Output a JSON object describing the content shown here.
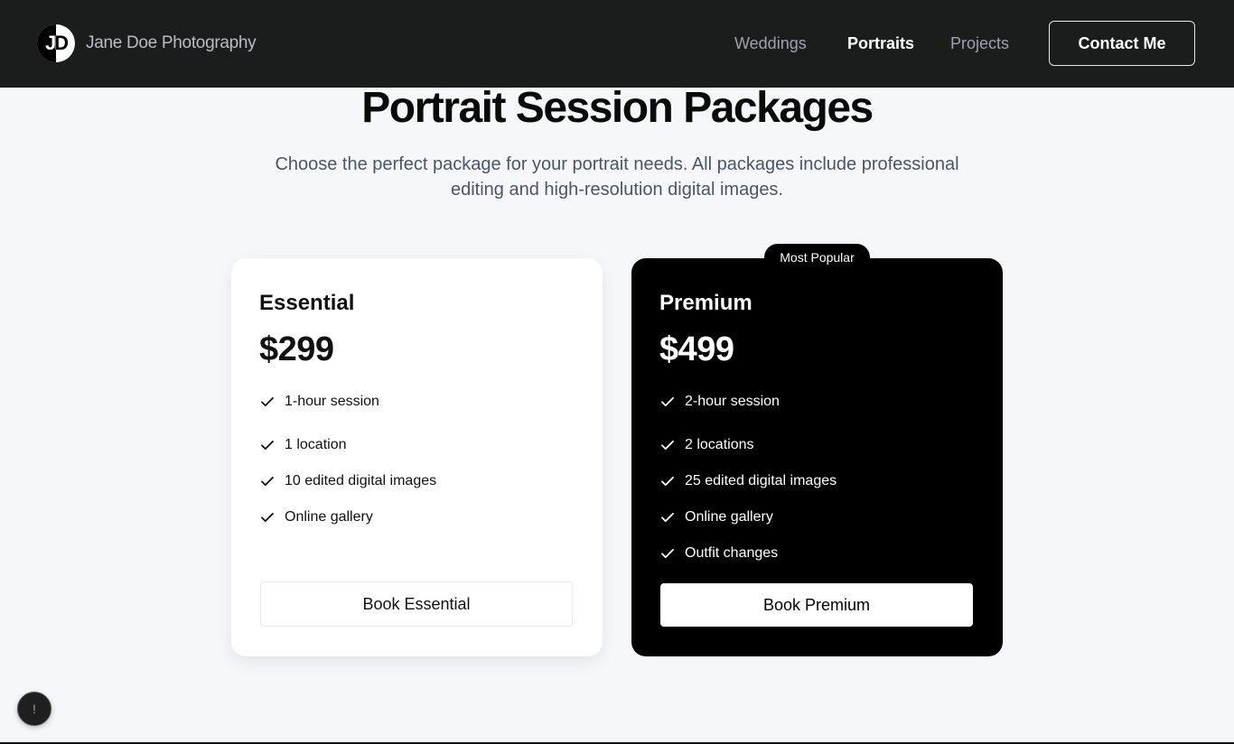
{
  "header": {
    "logo_monogram": "JD",
    "brand": "Jane Doe Photography",
    "nav": [
      {
        "label": "Weddings",
        "active": false
      },
      {
        "label": "Portraits",
        "active": true
      },
      {
        "label": "Projects",
        "active": false
      }
    ],
    "contact_label": "Contact Me"
  },
  "main": {
    "title": "Portrait Session Packages",
    "subtitle": "Choose the perfect package for your portrait needs. All packages include professional editing and high-resolution digital images."
  },
  "packages": [
    {
      "name": "Essential",
      "price": "$299",
      "features": [
        "1-hour session",
        "1 location",
        "10 edited digital images",
        "Online gallery"
      ],
      "button": "Book Essential"
    },
    {
      "name": "Premium",
      "price": "$499",
      "badge": "Most Popular",
      "features": [
        "2-hour session",
        "2 locations",
        "25 edited digital images",
        "Online gallery",
        "Outfit changes"
      ],
      "button": "Book Premium"
    }
  ],
  "help": {
    "icon": "exclamation-icon",
    "glyph": "!"
  },
  "colors": {
    "header_bg": "#1b1c1c",
    "page_bg": "#f5f7fa",
    "dark_card": "#000000",
    "accent_text": "#ffffff"
  }
}
